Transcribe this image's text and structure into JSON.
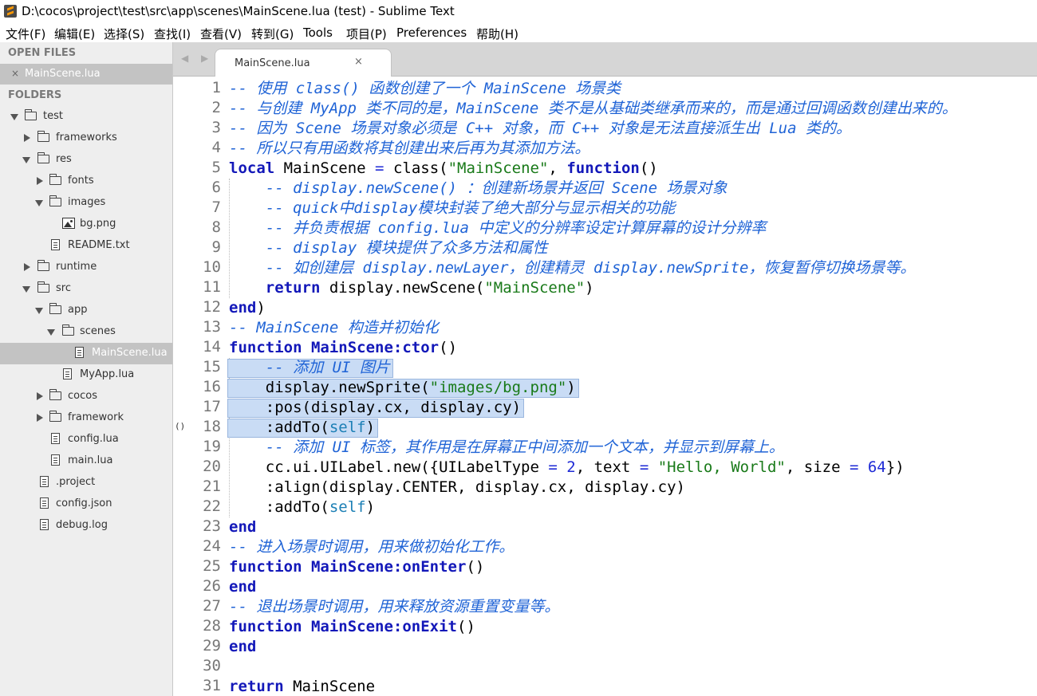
{
  "window": {
    "title": "D:\\cocos\\project\\test\\src\\app\\scenes\\MainScene.lua (test) - Sublime Text"
  },
  "menu": {
    "items": [
      "文件(F)",
      "编辑(E)",
      "选择(S)",
      "查找(I)",
      "查看(V)",
      "转到(G)",
      "Tools",
      "项目(P)",
      "Preferences",
      "帮助(H)"
    ]
  },
  "sidebar": {
    "open_files_header": "OPEN FILES",
    "open_files": [
      {
        "label": "MainScene.lua",
        "close": "×"
      }
    ],
    "folders_header": "FOLDERS",
    "tree": [
      {
        "label": "test",
        "kind": "folder",
        "expanded": true,
        "depth": 0
      },
      {
        "label": "frameworks",
        "kind": "folder",
        "expanded": false,
        "depth": 1
      },
      {
        "label": "res",
        "kind": "folder",
        "expanded": true,
        "depth": 1
      },
      {
        "label": "fonts",
        "kind": "folder",
        "expanded": false,
        "depth": 2
      },
      {
        "label": "images",
        "kind": "folder",
        "expanded": true,
        "depth": 2
      },
      {
        "label": "bg.png",
        "kind": "image",
        "depth": 3
      },
      {
        "label": "README.txt",
        "kind": "file",
        "depth": 2
      },
      {
        "label": "runtime",
        "kind": "folder",
        "expanded": false,
        "depth": 1
      },
      {
        "label": "src",
        "kind": "folder",
        "expanded": true,
        "depth": 1
      },
      {
        "label": "app",
        "kind": "folder",
        "expanded": true,
        "depth": 2
      },
      {
        "label": "scenes",
        "kind": "folder",
        "expanded": true,
        "depth": 3
      },
      {
        "label": "MainScene.lua",
        "kind": "file",
        "depth": 4,
        "selected": true
      },
      {
        "label": "MyApp.lua",
        "kind": "file",
        "depth": 3
      },
      {
        "label": "cocos",
        "kind": "folder",
        "expanded": false,
        "depth": 2
      },
      {
        "label": "framework",
        "kind": "folder",
        "expanded": false,
        "depth": 2
      },
      {
        "label": "config.lua",
        "kind": "file",
        "depth": 2
      },
      {
        "label": "main.lua",
        "kind": "file",
        "depth": 2
      },
      {
        "label": ".project",
        "kind": "file",
        "depth": 1
      },
      {
        "label": "config.json",
        "kind": "file",
        "depth": 1
      },
      {
        "label": "debug.log",
        "kind": "file",
        "depth": 1
      }
    ]
  },
  "tabs": {
    "nav": "◀ ▶",
    "active": {
      "label": "MainScene.lua",
      "close": "×"
    }
  },
  "editor": {
    "bracket_marker": "()",
    "lines": [
      {
        "n": "1",
        "tokens": [
          [
            "comment",
            "-- 使用 class() 函数创建了一个 MainScene 场景类"
          ]
        ]
      },
      {
        "n": "2",
        "tokens": [
          [
            "comment",
            "-- 与创建 MyApp 类不同的是，MainScene 类不是从基础类继承而来的，而是通过回调函数创建出来的。"
          ]
        ]
      },
      {
        "n": "3",
        "tokens": [
          [
            "comment",
            "-- 因为 Scene 场景对象必须是 C++ 对象，而 C++ 对象是无法直接派生出 Lua 类的。"
          ]
        ]
      },
      {
        "n": "4",
        "tokens": [
          [
            "comment",
            "-- 所以只有用函数将其创建出来后再为其添加方法。"
          ]
        ]
      },
      {
        "n": "5",
        "tokens": [
          [
            "keyword",
            "local"
          ],
          [
            "plain",
            " MainScene "
          ],
          [
            "op",
            "="
          ],
          [
            "plain",
            " class("
          ],
          [
            "string",
            "\"MainScene\""
          ],
          [
            "plain",
            ", "
          ],
          [
            "keyword",
            "function"
          ],
          [
            "plain",
            "()"
          ]
        ]
      },
      {
        "n": "6",
        "tokens": [
          [
            "plain",
            "    "
          ],
          [
            "comment",
            "-- display.newScene() ：创建新场景并返回 Scene 场景对象"
          ]
        ]
      },
      {
        "n": "7",
        "tokens": [
          [
            "plain",
            "    "
          ],
          [
            "comment",
            "-- quick中display模块封装了绝大部分与显示相关的功能"
          ]
        ]
      },
      {
        "n": "8",
        "tokens": [
          [
            "plain",
            "    "
          ],
          [
            "comment",
            "-- 并负责根据 config.lua 中定义的分辨率设定计算屏幕的设计分辨率"
          ]
        ]
      },
      {
        "n": "9",
        "tokens": [
          [
            "plain",
            "    "
          ],
          [
            "comment",
            "-- display 模块提供了众多方法和属性"
          ]
        ]
      },
      {
        "n": "10",
        "tokens": [
          [
            "plain",
            "    "
          ],
          [
            "comment",
            "-- 如创建层 display.newLayer，创建精灵 display.newSprite，恢复暂停切换场景等。"
          ]
        ]
      },
      {
        "n": "11",
        "tokens": [
          [
            "plain",
            "    "
          ],
          [
            "keyword",
            "return"
          ],
          [
            "plain",
            " display.newScene("
          ],
          [
            "string",
            "\"MainScene\""
          ],
          [
            "plain",
            ")"
          ]
        ]
      },
      {
        "n": "12",
        "tokens": [
          [
            "keyword",
            "end"
          ],
          [
            "plain",
            ")"
          ]
        ]
      },
      {
        "n": "13",
        "tokens": [
          [
            "comment",
            "-- MainScene 构造并初始化"
          ]
        ]
      },
      {
        "n": "14",
        "tokens": [
          [
            "keyword",
            "function"
          ],
          [
            "plain",
            " "
          ],
          [
            "keyword",
            "MainScene:ctor"
          ],
          [
            "plain",
            "()"
          ]
        ]
      },
      {
        "n": "15",
        "tokens": [
          [
            "plain",
            "    "
          ],
          [
            "comment",
            "-- 添加 UI 图片"
          ]
        ]
      },
      {
        "n": "16",
        "tokens": [
          [
            "plain",
            "    display.newSprite("
          ],
          [
            "string",
            "\"images/bg.png\""
          ],
          [
            "plain",
            ")"
          ]
        ]
      },
      {
        "n": "17",
        "tokens": [
          [
            "plain",
            "    :pos(display.cx, display.cy)"
          ]
        ]
      },
      {
        "n": "18",
        "tokens": [
          [
            "plain",
            "    :addTo("
          ],
          [
            "self",
            "self"
          ],
          [
            "plain",
            ")"
          ]
        ]
      },
      {
        "n": "19",
        "tokens": [
          [
            "plain",
            "    "
          ],
          [
            "comment",
            "-- 添加 UI 标签，其作用是在屏幕正中间添加一个文本，并显示到屏幕上。"
          ]
        ]
      },
      {
        "n": "20",
        "tokens": [
          [
            "plain",
            "    cc.ui.UILabel.new({UILabelType "
          ],
          [
            "op",
            "="
          ],
          [
            "plain",
            " "
          ],
          [
            "number",
            "2"
          ],
          [
            "plain",
            ", text "
          ],
          [
            "op",
            "="
          ],
          [
            "plain",
            " "
          ],
          [
            "string",
            "\"Hello, World\""
          ],
          [
            "plain",
            ", size "
          ],
          [
            "op",
            "="
          ],
          [
            "plain",
            " "
          ],
          [
            "number",
            "64"
          ],
          [
            "plain",
            "})"
          ]
        ]
      },
      {
        "n": "21",
        "tokens": [
          [
            "plain",
            "    :align(display.CENTER, display.cx, display.cy)"
          ]
        ]
      },
      {
        "n": "22",
        "tokens": [
          [
            "plain",
            "    :addTo("
          ],
          [
            "self",
            "self"
          ],
          [
            "plain",
            ")"
          ]
        ]
      },
      {
        "n": "23",
        "tokens": [
          [
            "keyword",
            "end"
          ]
        ]
      },
      {
        "n": "24",
        "tokens": [
          [
            "comment",
            "-- 进入场景时调用，用来做初始化工作。"
          ]
        ]
      },
      {
        "n": "25",
        "tokens": [
          [
            "keyword",
            "function"
          ],
          [
            "plain",
            " "
          ],
          [
            "keyword",
            "MainScene:onEnter"
          ],
          [
            "plain",
            "()"
          ]
        ]
      },
      {
        "n": "26",
        "tokens": [
          [
            "keyword",
            "end"
          ]
        ]
      },
      {
        "n": "27",
        "tokens": [
          [
            "comment",
            "-- 退出场景时调用，用来释放资源重置变量等。"
          ]
        ]
      },
      {
        "n": "28",
        "tokens": [
          [
            "keyword",
            "function"
          ],
          [
            "plain",
            " "
          ],
          [
            "keyword",
            "MainScene:onExit"
          ],
          [
            "plain",
            "()"
          ]
        ]
      },
      {
        "n": "29",
        "tokens": [
          [
            "keyword",
            "end"
          ]
        ]
      },
      {
        "n": "30",
        "tokens": []
      },
      {
        "n": "31",
        "tokens": [
          [
            "keyword",
            "return"
          ],
          [
            "plain",
            " MainScene"
          ]
        ]
      }
    ],
    "selected_lines": [
      "15",
      "16",
      "17",
      "18"
    ]
  },
  "colors": {
    "comment": "#1f63d6",
    "keyword": "#1318b9",
    "string": "#197a19",
    "selection": "#c9dcf5",
    "sidebar_bg": "#eeeeee",
    "sidebar_selected": "#c3c3c3"
  }
}
